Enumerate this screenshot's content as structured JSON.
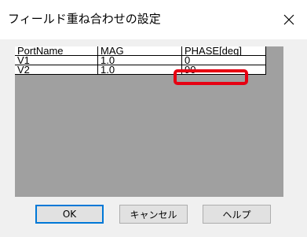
{
  "window": {
    "title": "フィールド重ね合わせの設定"
  },
  "grid": {
    "columns": [
      "PortName",
      "MAG",
      "PHASE[deg]"
    ],
    "rows": [
      [
        "V1",
        "1.0",
        "0"
      ],
      [
        "V2",
        "1.0",
        "90"
      ]
    ]
  },
  "buttons": {
    "ok": "OK",
    "cancel": "キャンセル",
    "help": "ヘルプ"
  },
  "colors": {
    "highlight": "#e60012",
    "grid_background": "#a0a0a0",
    "focus_border": "#0078d7"
  },
  "icons": {
    "close": "close-icon"
  }
}
